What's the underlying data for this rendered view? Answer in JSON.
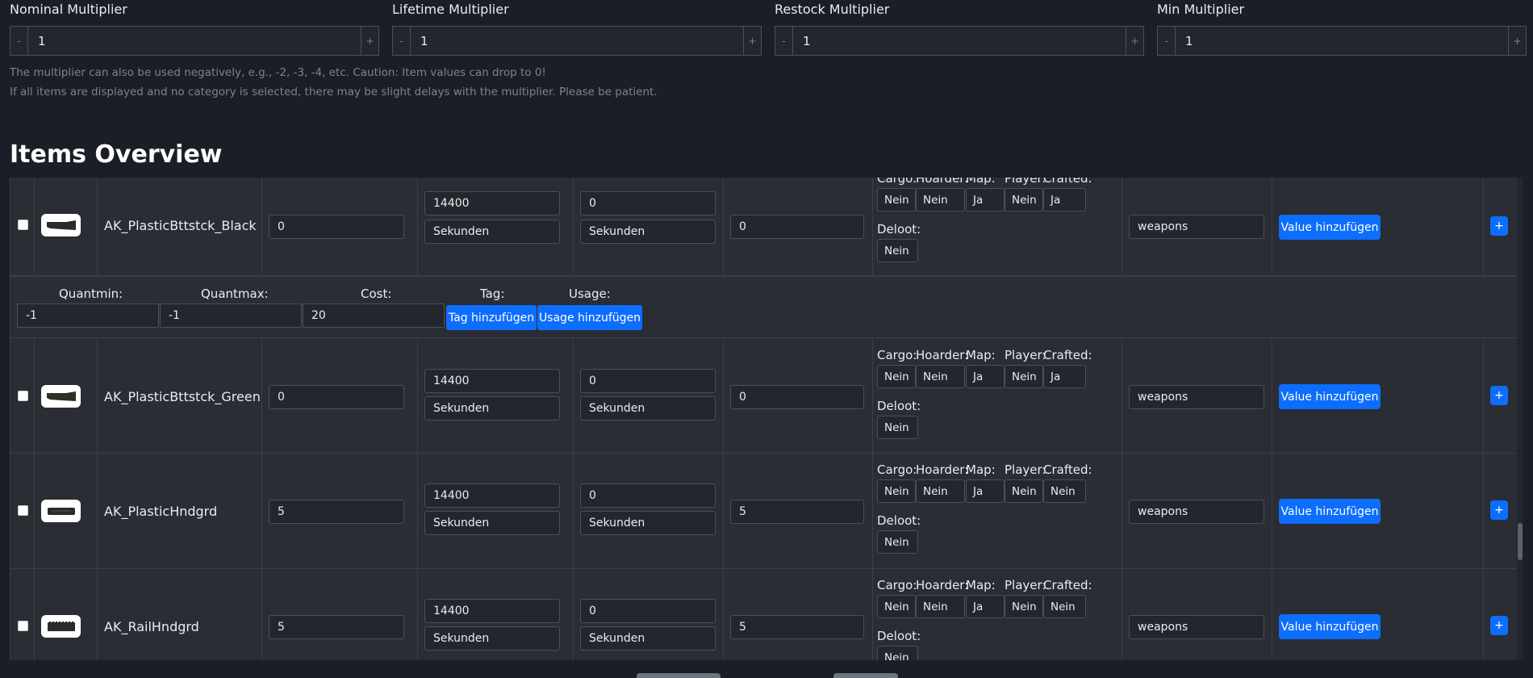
{
  "multipliers": [
    {
      "label": "Nominal Multiplier",
      "value": "1",
      "minus": "-",
      "plus": "+"
    },
    {
      "label": "Lifetime Multiplier",
      "value": "1",
      "minus": "-",
      "plus": "+"
    },
    {
      "label": "Restock Multiplier",
      "value": "1",
      "minus": "-",
      "plus": "+"
    },
    {
      "label": "Min Multiplier",
      "value": "1",
      "minus": "-",
      "plus": "+"
    }
  ],
  "hints": [
    "The multiplier can also be used negatively, e.g., -2, -3, -4, etc. Caution: Item values can drop to 0!",
    "If all items are displayed and no category is selected, there may be slight delays with the multiplier. Please be patient."
  ],
  "section_title": "Items Overview",
  "flag_labels": {
    "cargo": "Cargo:",
    "hoarder": "Hoarder:",
    "map": "Map:",
    "player": "Player:",
    "crafted": "Crafted:",
    "deloot": "Deloot:"
  },
  "value_button": "Value hinzufügen",
  "plus_button": "+",
  "items": [
    {
      "name": "AK_PlasticBttstck_Black",
      "nominal": "0",
      "lifetime": "14400",
      "lifetime_unit": "Sekunden",
      "restock": "0",
      "restock_unit": "Sekunden",
      "min": "0",
      "cargo": "Nein",
      "hoarder": "Nein",
      "map": "Ja",
      "player": "Nein",
      "crafted": "Ja",
      "deloot": "Nein",
      "category": "weapons"
    },
    {
      "name": "AK_PlasticBttstck_Green",
      "nominal": "0",
      "lifetime": "14400",
      "lifetime_unit": "Sekunden",
      "restock": "0",
      "restock_unit": "Sekunden",
      "min": "0",
      "cargo": "Nein",
      "hoarder": "Nein",
      "map": "Ja",
      "player": "Nein",
      "crafted": "Ja",
      "deloot": "Nein",
      "category": "weapons"
    },
    {
      "name": "AK_PlasticHndgrd",
      "nominal": "5",
      "lifetime": "14400",
      "lifetime_unit": "Sekunden",
      "restock": "0",
      "restock_unit": "Sekunden",
      "min": "5",
      "cargo": "Nein",
      "hoarder": "Nein",
      "map": "Ja",
      "player": "Nein",
      "crafted": "Nein",
      "deloot": "Nein",
      "category": "weapons"
    },
    {
      "name": "AK_RailHndgrd",
      "nominal": "5",
      "lifetime": "14400",
      "lifetime_unit": "Sekunden",
      "restock": "0",
      "restock_unit": "Sekunden",
      "min": "5",
      "cargo": "Nein",
      "hoarder": "Nein",
      "map": "Ja",
      "player": "Nein",
      "crafted": "Nein",
      "deloot": "Nein",
      "category": "weapons"
    }
  ],
  "detail": {
    "quantmin_label": "Quantmin:",
    "quantmax_label": "Quantmax:",
    "cost_label": "Cost:",
    "tag_label": "Tag:",
    "usage_label": "Usage:",
    "quantmin": "-1",
    "quantmax": "-1",
    "cost": "20",
    "tag_button": "Tag hinzufügen",
    "usage_button": "Usage hinzufügen"
  },
  "colors": {
    "background": "#1b1e27",
    "row": "#2a2d33",
    "accent": "#0d6efd"
  }
}
